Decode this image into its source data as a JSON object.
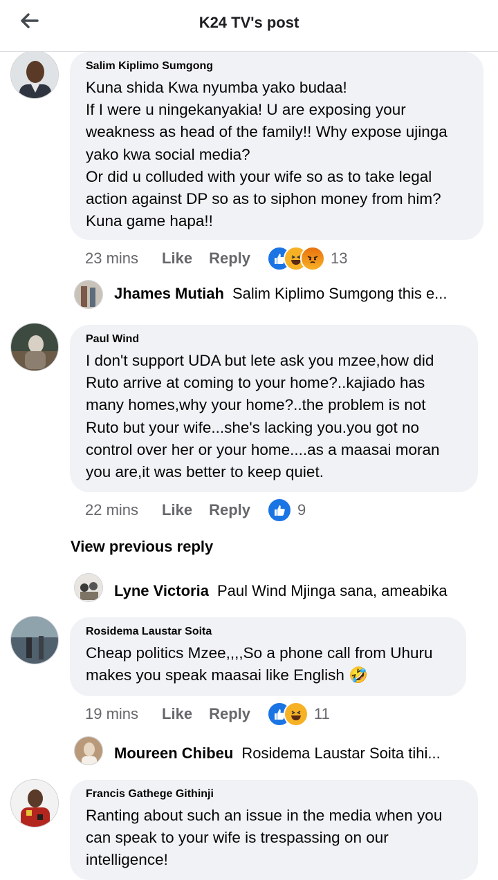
{
  "header": {
    "title": "K24 TV's post"
  },
  "comments": [
    {
      "author": "Salim Kiplimo Sumgong",
      "lines": [
        "Kuna shida Kwa nyumba yako budaa!",
        "If I were u ningekanyakia! U are exposing your",
        "weakness as head of the family!! Why expose ujinga",
        "yako kwa social media?",
        "Or did u colluded with your wife so as to take legal",
        "action against DP so as to siphon money from him?",
        "Kuna game hapa!!"
      ],
      "time": "23 mins",
      "like_label": "Like",
      "reply_label": "Reply",
      "reactions": [
        "like",
        "haha",
        "angry"
      ],
      "reaction_count": "13",
      "reply": {
        "name": "Jhames Mutiah",
        "text": "Salim Kiplimo Sumgong this e..."
      }
    },
    {
      "author": "Paul Wind",
      "lines": [
        "I don't support UDA but lete ask you mzee,how did",
        "Ruto arrive at coming to your home?..kajiado has",
        "many homes,why your home?..the problem is not",
        "Ruto but your wife...she's lacking you.you got no",
        "control over her or your home....as a maasai moran",
        "you are,it was better to keep quiet."
      ],
      "time": "22 mins",
      "like_label": "Like",
      "reply_label": "Reply",
      "reactions": [
        "like"
      ],
      "reaction_count": "9",
      "view_previous": "View previous reply",
      "reply": {
        "name": "Lyne Victoria",
        "text": "Paul Wind Mjinga sana, ameabika"
      }
    },
    {
      "author": "Rosidema Laustar Soita",
      "lines": [
        "Cheap politics Mzee,,,,So a phone call from Uhuru",
        "makes you speak maasai like English 🤣"
      ],
      "time": "19 mins",
      "like_label": "Like",
      "reply_label": "Reply",
      "reactions": [
        "like",
        "haha"
      ],
      "reaction_count": "11",
      "reply": {
        "name": "Moureen Chibeu",
        "text": "Rosidema Laustar Soita  tihi..."
      }
    },
    {
      "author": "Francis Gathege Githinji",
      "lines": [
        "Ranting about such an issue in the media when you",
        "can speak to your wife is trespassing on our",
        "intelligence!"
      ]
    }
  ],
  "colors": {
    "bubble": "#f0f2f5",
    "meta": "#65676b",
    "like_blue": "#1b74e4"
  }
}
